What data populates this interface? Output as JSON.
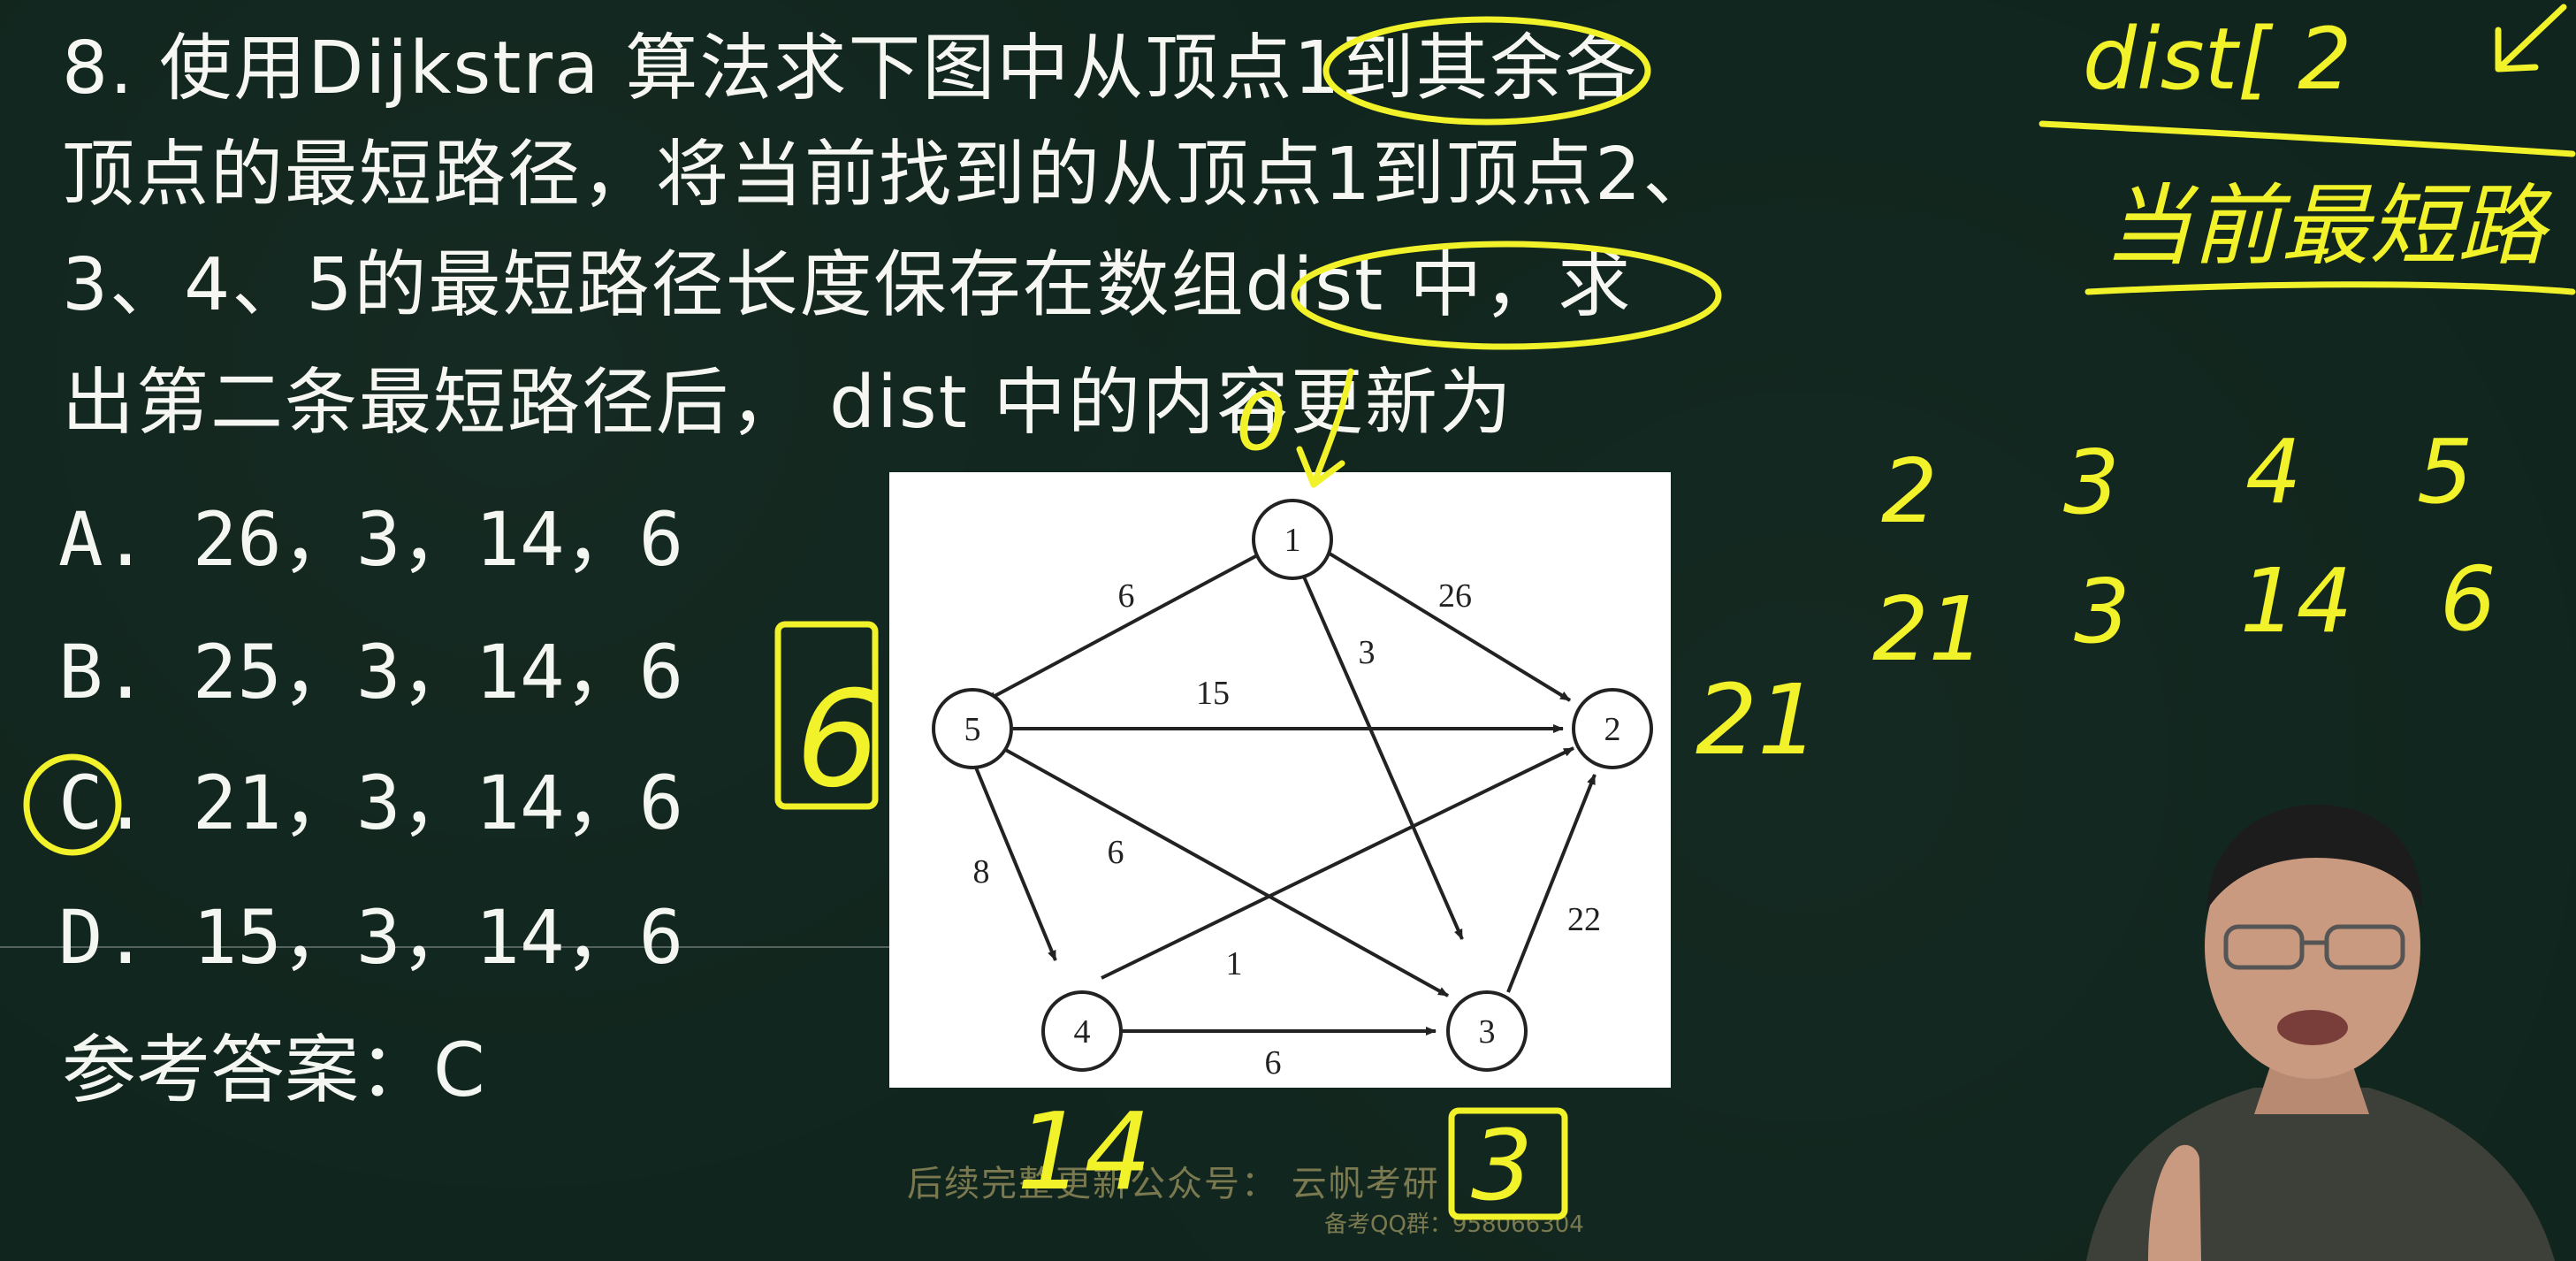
{
  "question": {
    "lines": [
      "8. 使用Dijkstra 算法求下图中从顶点1到其余各",
      "顶点的最短路径，将当前找到的从顶点1到顶点2、",
      "3、4、5的最短路径长度保存在数组dist 中，求",
      "出第二条最短路径后， dist 中的内容更新为"
    ]
  },
  "options": [
    {
      "label": "A.  26，3，14，6"
    },
    {
      "label": "B. 25，3，14，6"
    },
    {
      "label": "C.  21，3，14，6"
    },
    {
      "label": "D. 15，3，14，6"
    }
  ],
  "answer": "参考答案：C",
  "graph": {
    "vertices": [
      "1",
      "2",
      "3",
      "4",
      "5"
    ],
    "edges": [
      {
        "from": "1",
        "to": "5",
        "weight": "6"
      },
      {
        "from": "1",
        "to": "2",
        "weight": "26"
      },
      {
        "from": "1",
        "to": "3",
        "weight": "3"
      },
      {
        "from": "5",
        "to": "2",
        "weight": "15"
      },
      {
        "from": "5",
        "to": "4",
        "weight": "8"
      },
      {
        "from": "5",
        "to": "3",
        "weight": "6"
      },
      {
        "from": "4",
        "to": "2",
        "weight": "1"
      },
      {
        "from": "4",
        "to": "3",
        "weight": "6"
      },
      {
        "from": "3",
        "to": "2",
        "weight": "22"
      }
    ]
  },
  "annotations": {
    "top_right_1": "dist[ 2",
    "top_right_2": "当前最短路",
    "vertex_1_zero": "0",
    "vertex_5_dist": "6",
    "vertex_2_dist": "21",
    "vertex_4_dist": "14",
    "vertex_3_dist": "3",
    "table_header": [
      "2",
      "3",
      "4",
      "5"
    ],
    "table_values": [
      "21",
      "3",
      "14",
      "6"
    ]
  },
  "watermark": {
    "main": "后续完整更新公众号： 云帆考研",
    "qq": "备考QQ群：958066304"
  },
  "colors": {
    "board": "#10251d",
    "chalk": "#f4f6f2",
    "marker_yellow": "#f2f22a"
  }
}
